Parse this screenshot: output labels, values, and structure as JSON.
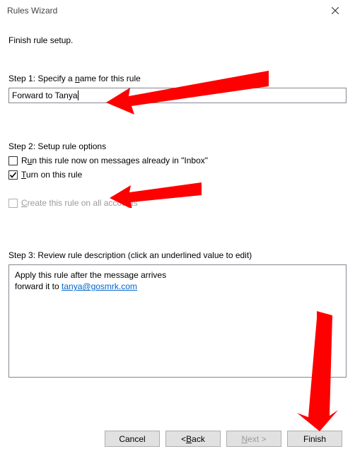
{
  "window": {
    "title": "Rules Wizard"
  },
  "subtitle": "Finish rule setup.",
  "step1": {
    "label_pre": "Step 1: Specify a ",
    "label_u": "n",
    "label_post": "ame for this rule",
    "value": "Forward to Tanya"
  },
  "step2": {
    "label": "Step 2: Setup rule options",
    "run_now_pre": "R",
    "run_now_u": "u",
    "run_now_post": "n this rule now on messages already in \"Inbox\"",
    "turn_on_u": "T",
    "turn_on_post": "urn on this rule",
    "create_all_u": "C",
    "create_all_post": "reate this rule on all accounts"
  },
  "step3": {
    "label": "Step 3: Review rule description (click an underlined value to edit)",
    "line1": "Apply this rule after the message arrives",
    "line2_pre": "forward it to ",
    "line2_link": "tanya@gosmrk.com"
  },
  "buttons": {
    "cancel": "Cancel",
    "back_sym": "< ",
    "back_u": "B",
    "back_post": "ack",
    "next_u": "N",
    "next_post": "ext >",
    "finish": "Finish"
  }
}
